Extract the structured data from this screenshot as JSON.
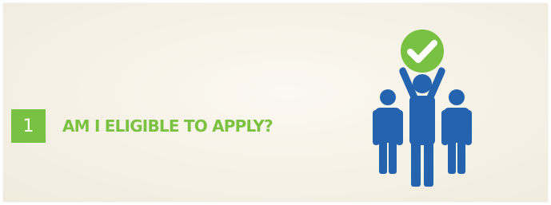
{
  "step": {
    "number": "1",
    "question": "AM I ELIGIBLE TO APPLY?"
  },
  "illustration": {
    "icon": "people-group-eligible-icon",
    "badge_icon": "checkmark-icon"
  },
  "colors": {
    "accent_green": "#78c143",
    "people_blue": "#2463ad",
    "background": "#f6f1e6"
  }
}
